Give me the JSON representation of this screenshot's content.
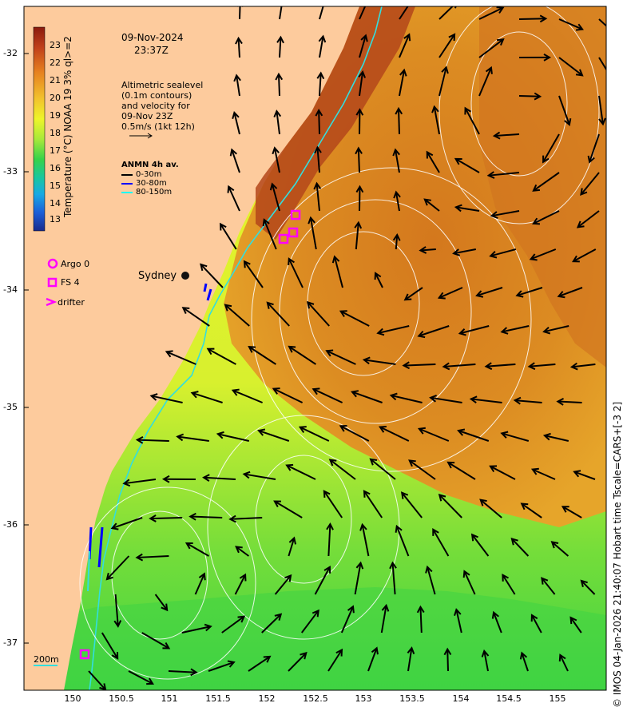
{
  "header": {
    "date": "09-Nov-2024",
    "time": "23:37Z"
  },
  "notes": {
    "lines": [
      "Altimetric sealevel",
      "(0.1m contours)",
      "and velocity for",
      "09-Nov 23Z",
      "0.5m/s (1kt 12h)"
    ]
  },
  "anmn": {
    "title": "ANMN 4h av.",
    "items": [
      {
        "label": "0-30m",
        "color": "#000000"
      },
      {
        "label": "30-80m",
        "color": "#0000ff"
      },
      {
        "label": "80-150m",
        "color": "#00ffff"
      }
    ]
  },
  "markers_legend": [
    {
      "label": "Argo 0",
      "symbol": "circle",
      "color": "#ff00ff"
    },
    {
      "label": "FS 4",
      "symbol": "square",
      "color": "#ff00ff"
    },
    {
      "label": "drifter",
      "symbol": "chevron",
      "color": "#ff00ff"
    }
  ],
  "colorbar": {
    "label": "Temperature (°C) NOAA 19 3% ql>=2",
    "ticks": [
      "23",
      "22",
      "21",
      "20",
      "19",
      "18",
      "17",
      "16",
      "15",
      "14",
      "13"
    ]
  },
  "place_label": "Sydney",
  "scale_label": "200m",
  "y_ticks": [
    "-32",
    "-33",
    "-34",
    "-35",
    "-36",
    "-37"
  ],
  "x_ticks": [
    "150",
    "150.5",
    "151",
    "151.5",
    "152",
    "152.5",
    "153",
    "153.5",
    "154",
    "154.5",
    "155"
  ],
  "credit": "© IMOS 04-Jan-2026 21:40:07 Hobart time Tscale=CARS+[-3 2]",
  "colors": {
    "land": "#fdcb9d",
    "warm": "#d9821f",
    "hot": "#b4461a",
    "cool": "#e7f32a",
    "cold": "#52d63a",
    "shelf": "#38e0e0"
  }
}
